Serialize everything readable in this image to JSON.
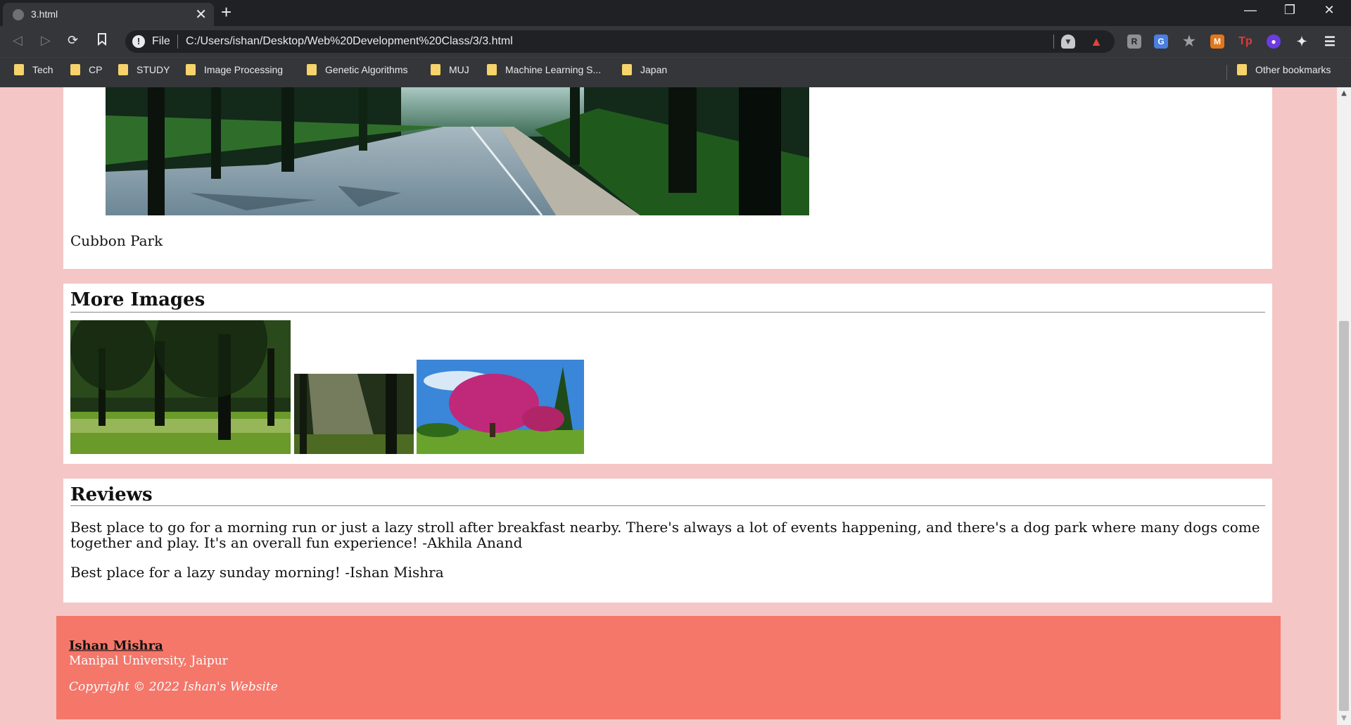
{
  "browser": {
    "tab_title": "3.html",
    "close_glyph": "✕",
    "new_tab_glyph": "+",
    "scheme_label": "File",
    "url": "C:/Users/ishan/Desktop/Web%20Development%20Class/3/3.html",
    "info_glyph": "!",
    "bookmarks": [
      "Tech",
      "CP",
      "STUDY",
      "Image Processing",
      "Genetic Algorithms",
      "MUJ",
      "Machine Learning S...",
      "Japan"
    ],
    "other_bookmarks": "Other bookmarks"
  },
  "page": {
    "park_caption": "Cubbon Park",
    "more_images_heading": "More Images",
    "reviews_heading": "Reviews",
    "reviews": [
      "Best place to go for a morning run or just a lazy stroll after breakfast nearby. There's always a lot of events happening, and there's a dog park where many dogs come together and play. It's an overall fun experience! -Akhila Anand",
      "Best place for a lazy sunday morning! -Ishan Mishra"
    ]
  },
  "footer": {
    "name": "Ishan Mishra",
    "university": "Manipal University, Jaipur",
    "copyright": "Copyright © 2022 Ishan's Website"
  },
  "colors": {
    "page_background": "#f5c6c6",
    "footer_background": "#f4776a",
    "card_background": "#ffffff"
  }
}
